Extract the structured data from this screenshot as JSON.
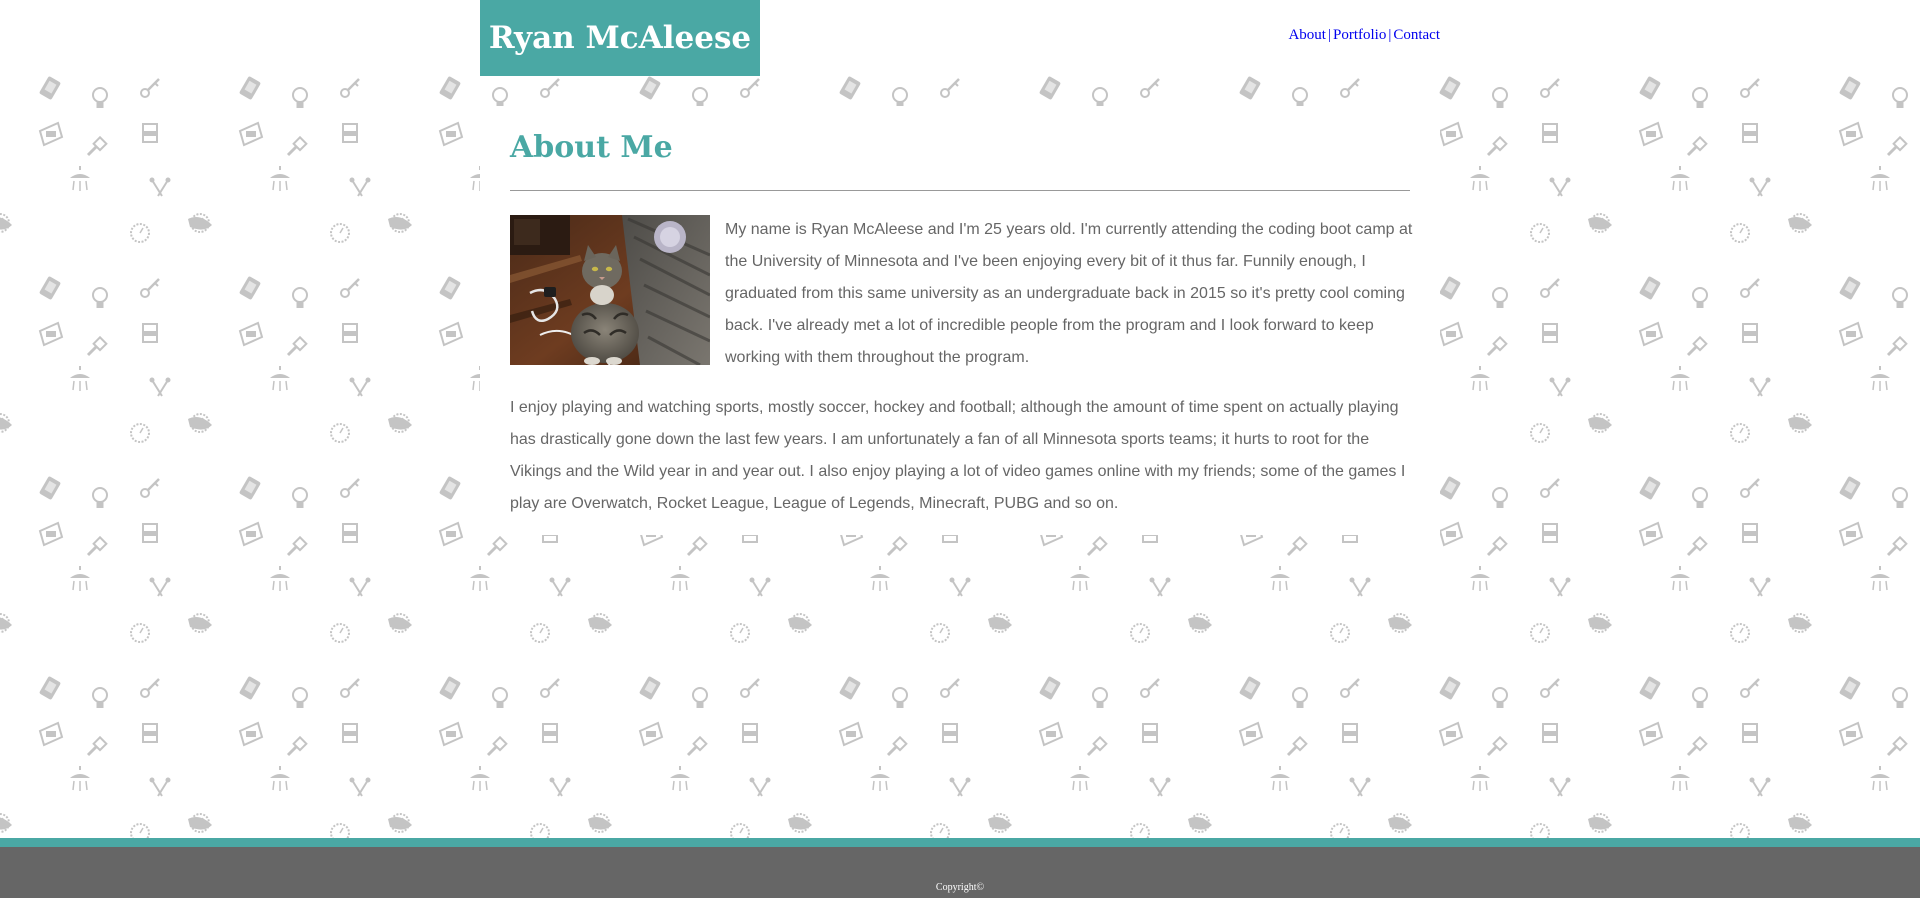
{
  "colors": {
    "accent": "#4aa8a4",
    "text": "#666666",
    "footer_bg": "#666666",
    "link": "#0000ee",
    "pattern_icon": "#c4c4c4"
  },
  "header": {
    "brand": "Ryan McAleese",
    "nav": [
      {
        "label": "About"
      },
      {
        "label": "Portfolio"
      },
      {
        "label": "Contact"
      }
    ],
    "separator": "|"
  },
  "background_pattern_icons": [
    "phone-icon",
    "lightbulb-icon",
    "key-icon",
    "paintbrush-icon",
    "printer-icon",
    "cabinet-icon",
    "shower-icon",
    "garden-tools-icon",
    "mouse-icon",
    "clock-icon"
  ],
  "about": {
    "title": "About Me",
    "photo_icon": "cat-photo",
    "paragraph1": "My name is Ryan McAleese and I'm 25 years old. I'm currently attending the coding boot camp at the University of Minnesota and I've been enjoying every bit of it thus far. Funnily enough, I graduated from this same university as an undergraduate back in 2015 so it's pretty cool coming back. I've already met a lot of incredible people from the program and I look forward to keep working with them throughout the program.",
    "paragraph2": "I enjoy playing and watching sports, mostly soccer, hockey and football; although the amount of time spent on actually playing has drastically gone down the last few years. I am unfortunately a fan of all Minnesota sports teams; it hurts to root for the Vikings and the Wild year in and year out. I also enjoy playing a lot of video games online with my friends; some of the games I play are Overwatch, Rocket League, League of Legends, Minecraft, PUBG and so on."
  },
  "footer": {
    "copyright": "Copyright©"
  }
}
